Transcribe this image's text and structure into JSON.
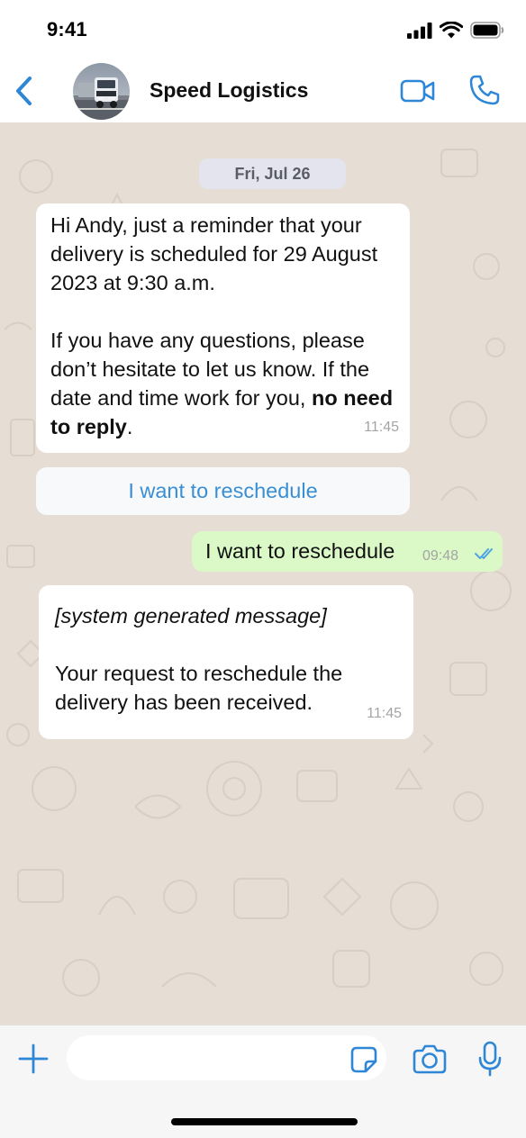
{
  "status_bar": {
    "time": "9:41",
    "icons": [
      "cellular-signal-icon",
      "wifi-icon",
      "battery-icon"
    ]
  },
  "header": {
    "contact_name": "Speed Logistics",
    "avatar_subject": "truck-photo",
    "icons": [
      "back-chevron-icon",
      "video-call-icon",
      "phone-call-icon"
    ]
  },
  "chat": {
    "date_label": "Fri, Jul 26",
    "messages": [
      {
        "direction": "incoming",
        "para1": "Hi Andy, just a reminder that your delivery is scheduled for 29 August 2023 at 9:30 a.m.",
        "para2_lead": "If you have any questions, please don’t hesitate to let us know. If the date and time work for you,",
        "para2_bold": "no need to reply",
        "para2_tail": ".",
        "time": "11:45"
      },
      {
        "direction": "incoming",
        "line1": "[system generated message]",
        "line2": "Your request to reschedule the delivery has been received.",
        "time": "11:45"
      }
    ],
    "quick_reply_button": "I want to reschedule",
    "outgoing": {
      "text": "I want to reschedule",
      "time": "09:48",
      "status": "read-double-check"
    }
  },
  "input_bar": {
    "placeholder": "",
    "icons": [
      "plus-icon",
      "sticker-icon",
      "camera-icon",
      "microphone-icon"
    ]
  },
  "colors": {
    "accent": "#2e87d6",
    "chat_background": "#e6ddd4",
    "outgoing_bubble": "#dbf8c7",
    "incoming_bubble": "#ffffff",
    "quick_reply_text": "#3a8fd4",
    "timestamp": "#a4a4a4"
  }
}
